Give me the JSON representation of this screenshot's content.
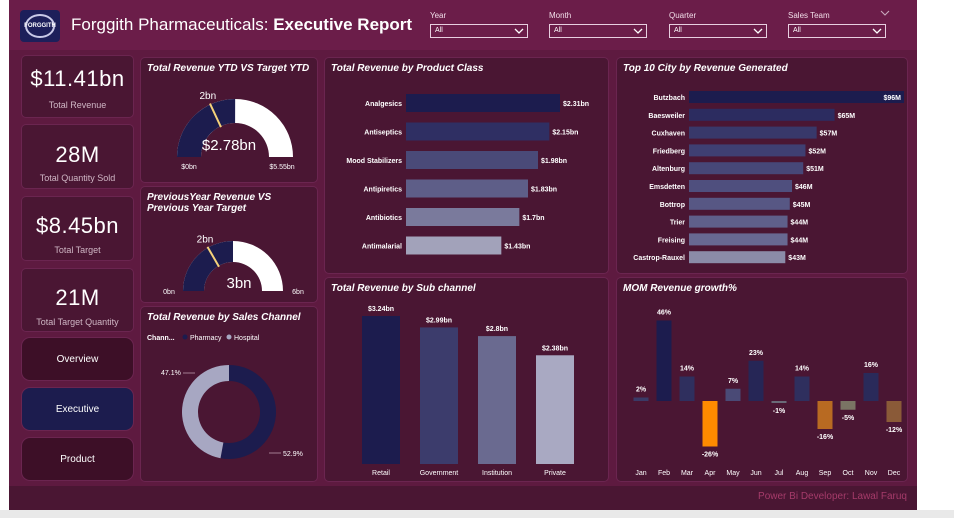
{
  "header": {
    "logo_text": "FORGGITH",
    "title_plain": "Forggith Pharmaceuticals: ",
    "title_bold": "Executive Report"
  },
  "slicers": [
    {
      "label": "Year",
      "value": "All"
    },
    {
      "label": "Month",
      "value": "All"
    },
    {
      "label": "Quarter",
      "value": "All"
    },
    {
      "label": "Sales Team",
      "value": "All"
    }
  ],
  "kpis": [
    {
      "value": "$11.41bn",
      "label": "Total Revenue"
    },
    {
      "value": "28M",
      "label": "Total Quantity Sold"
    },
    {
      "value": "$8.45bn",
      "label": "Total Target"
    },
    {
      "value": "21M",
      "label": "Total Target Quantity"
    }
  ],
  "nav": {
    "overview": "Overview",
    "executive": "Executive",
    "product": "Product"
  },
  "footer": {
    "credit": "Power Bi Developer: Lawal Faruq"
  },
  "colors": {
    "background": "#5e1a40",
    "panel": "#4a1633",
    "navy": "#1c1c4e",
    "active_nav": "#1c1c4e",
    "negative": "#ff8a00",
    "gauge_rest": "#ffffff",
    "target_marker": "#f5d27a"
  },
  "chart_data": [
    {
      "id": "gauge_ytd",
      "type": "gauge",
      "title": "Total Revenue YTD VS Target YTD",
      "value_label": "$2.78bn",
      "value": 2.78,
      "min_label": "$0bn",
      "max_label": "$5.55bn",
      "min": 0,
      "max": 5.55,
      "target_label": "2bn",
      "target": 2
    },
    {
      "id": "gauge_py",
      "type": "gauge",
      "title": "PreviousYear Revenue VS Previous Year Target",
      "value_label": "3bn",
      "value": 3,
      "min_label": "0bn",
      "max_label": "6bn",
      "min": 0,
      "max": 6,
      "target_label": "2bn",
      "target": 2
    },
    {
      "id": "donut_channel",
      "type": "pie",
      "title": "Total Revenue by Sales Channel",
      "legend_title": "Chann...",
      "slices": [
        {
          "name": "Pharmacy",
          "value": 52.9,
          "label": "52.9%",
          "color": "#1c1c4e"
        },
        {
          "name": "Hospital",
          "value": 47.1,
          "label": "47.1%",
          "color": "#a7a7c2"
        }
      ]
    },
    {
      "id": "bar_product_class",
      "type": "bar",
      "orientation": "horizontal",
      "title": "Total Revenue by Product Class",
      "categories": [
        "Analgesics",
        "Antiseptics",
        "Mood Stabilizers",
        "Antipiretics",
        "Antibiotics",
        "Antimalarial"
      ],
      "values": [
        2.31,
        2.15,
        1.98,
        1.83,
        1.7,
        1.43
      ],
      "labels": [
        "$2.31bn",
        "$2.15bn",
        "$1.98bn",
        "$1.83bn",
        "$1.7bn",
        "$1.43bn"
      ],
      "colors": [
        "#1c1c4e",
        "#2f2f63",
        "#4a4a78",
        "#5e5e88",
        "#7a7a9c",
        "#a2a2ba"
      ]
    },
    {
      "id": "bar_city",
      "type": "bar",
      "orientation": "horizontal",
      "title": "Top 10 City by Revenue Generated",
      "categories": [
        "Butzbach",
        "Baesweiler",
        "Cuxhaven",
        "Friedberg",
        "Altenburg",
        "Emsdetten",
        "Bottrop",
        "Trier",
        "Freising",
        "Castrop-Rauxel"
      ],
      "values": [
        96,
        65,
        57,
        52,
        51,
        46,
        45,
        44,
        44,
        43
      ],
      "labels": [
        "$96M",
        "$65M",
        "$57M",
        "$52M",
        "$51M",
        "$46M",
        "$45M",
        "$44M",
        "$44M",
        "$43M"
      ],
      "colors": [
        "#1c1c4e",
        "#2c2c60",
        "#38386a",
        "#3f3f72",
        "#474778",
        "#4f4f7e",
        "#575784",
        "#5f5f8a",
        "#686892",
        "#8b8ba8"
      ]
    },
    {
      "id": "col_subchannel",
      "type": "bar",
      "orientation": "vertical",
      "title": "Total Revenue by Sub channel",
      "categories": [
        "Retail",
        "Government",
        "Institution",
        "Private"
      ],
      "values": [
        3.24,
        2.99,
        2.8,
        2.38
      ],
      "labels": [
        "$3.24bn",
        "$2.99bn",
        "$2.8bn",
        "$2.38bn"
      ],
      "colors": [
        "#1c1c4e",
        "#3c3c6c",
        "#6a6a90",
        "#a9a9c2"
      ]
    },
    {
      "id": "col_mom",
      "type": "bar",
      "orientation": "vertical",
      "title": "MOM Revenue growth%",
      "categories": [
        "Jan",
        "Feb",
        "Mar",
        "Apr",
        "May",
        "Jun",
        "Jul",
        "Aug",
        "Sep",
        "Oct",
        "Nov",
        "Dec"
      ],
      "values": [
        2,
        46,
        14,
        -26,
        7,
        23,
        -1,
        14,
        -16,
        -5,
        16,
        -12
      ],
      "labels": [
        "2%",
        "46%",
        "14%",
        "-26%",
        "7%",
        "23%",
        "-1%",
        "14%",
        "-16%",
        "-5%",
        "16%",
        "-12%"
      ],
      "colors": [
        "#3a3a66",
        "#1c1c4e",
        "#2f2f5e",
        "#ff8a00",
        "#4a4a76",
        "#262656",
        "#6a6a78",
        "#2f2f5e",
        "#b86a22",
        "#7a7464",
        "#2a2a5a",
        "#8a5a38"
      ]
    }
  ]
}
